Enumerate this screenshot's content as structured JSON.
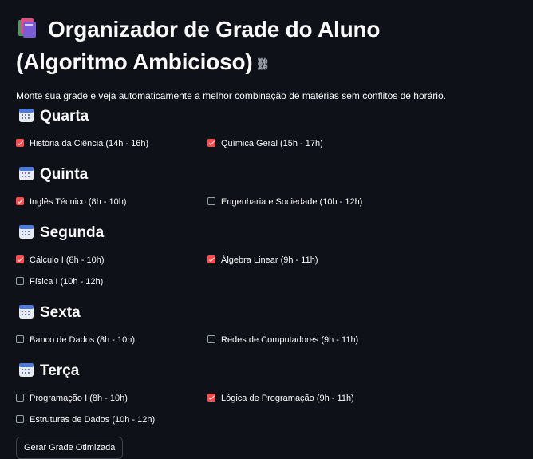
{
  "header": {
    "title_line1": "Organizador de Grade do Aluno",
    "title_line2": "(Algoritmo Ambicioso)",
    "subtitle": "Monte sua grade e veja automaticamente a melhor combinação de matérias sem conflitos de horário."
  },
  "days": [
    {
      "name": "Quarta",
      "courses": [
        {
          "label": "História da Ciência (14h - 16h)",
          "checked": true
        },
        {
          "label": "Química Geral (15h - 17h)",
          "checked": true
        }
      ]
    },
    {
      "name": "Quinta",
      "courses": [
        {
          "label": "Inglês Técnico (8h - 10h)",
          "checked": true
        },
        {
          "label": "Engenharia e Sociedade (10h - 12h)",
          "checked": false
        }
      ]
    },
    {
      "name": "Segunda",
      "courses": [
        {
          "label": "Cálculo I (8h - 10h)",
          "checked": true
        },
        {
          "label": "Álgebra Linear (9h - 11h)",
          "checked": true
        },
        {
          "label": "Física I (10h - 12h)",
          "checked": false
        }
      ]
    },
    {
      "name": "Sexta",
      "courses": [
        {
          "label": "Banco de Dados (8h - 10h)",
          "checked": false
        },
        {
          "label": "Redes de Computadores (9h - 11h)",
          "checked": false
        }
      ]
    },
    {
      "name": "Terça",
      "courses": [
        {
          "label": "Programação I (8h - 10h)",
          "checked": false
        },
        {
          "label": "Lógica de Programação (9h - 11h)",
          "checked": true
        },
        {
          "label": "Estruturas de Dados (10h - 12h)",
          "checked": false
        }
      ]
    }
  ],
  "actions": {
    "generate_label": "Gerar Grade Otimizada"
  },
  "icons": {
    "title": "books-icon",
    "link": "link-icon",
    "day": "calendar-icon"
  },
  "colors": {
    "accent": "#ff4b4b",
    "background": "#0e1117"
  }
}
